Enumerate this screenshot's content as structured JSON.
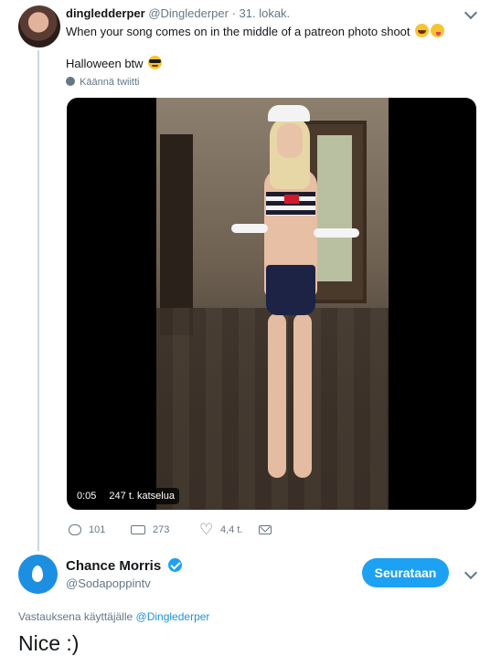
{
  "tweet1": {
    "name": "dingledderper",
    "handle": "@Dinglederper",
    "date": "· 31. lokak.",
    "text": "When your song comes on in the middle of a patreon photo shoot",
    "text2": "Halloween btw",
    "translate_label": "Käännä twiitti",
    "video": {
      "time": "0:05",
      "views": "247 t. katselua"
    },
    "actions": {
      "reply_count": "101",
      "retweet_count": "273",
      "like_count": "4,4 t."
    }
  },
  "tweet2": {
    "name": "Chance Morris",
    "handle": "@Sodapoppintv",
    "follow_label": "Seurataan",
    "reply_prefix": "Vastauksena käyttäjälle",
    "reply_handle": "@Dinglederper",
    "text": "Nice :)"
  },
  "colors": {
    "accent": "#1da1f2",
    "link": "#1b95e0",
    "muted": "#657786",
    "text": "#14171a"
  },
  "icons": [
    "chevron-down-icon",
    "globe-icon",
    "reply-icon",
    "retweet-icon",
    "heart-icon",
    "dm-icon",
    "verified-icon"
  ]
}
